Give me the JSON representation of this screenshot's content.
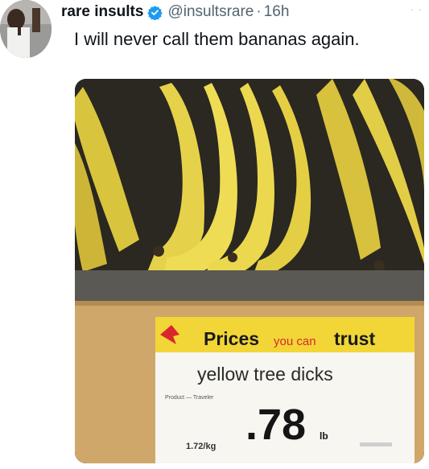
{
  "tweet": {
    "display_name": "rare insults",
    "handle": "@insultsrare",
    "separator": "·",
    "time": "16h",
    "text": "I will never call them bananas again.",
    "more": "· ·"
  },
  "photo": {
    "sign": {
      "brand_main": "Prices",
      "brand_mid": "you can",
      "brand_end": "trust",
      "product": "yellow tree dicks",
      "small_line": "Product — Traveler",
      "price": ".78",
      "unit": "lb",
      "per_kg": "1.72/kg"
    }
  },
  "colors": {
    "verified_badge": "#1d9bf0",
    "banana": "#e8d34a",
    "sign_yellow": "#f2d637",
    "shelf": "#d2a96f"
  }
}
